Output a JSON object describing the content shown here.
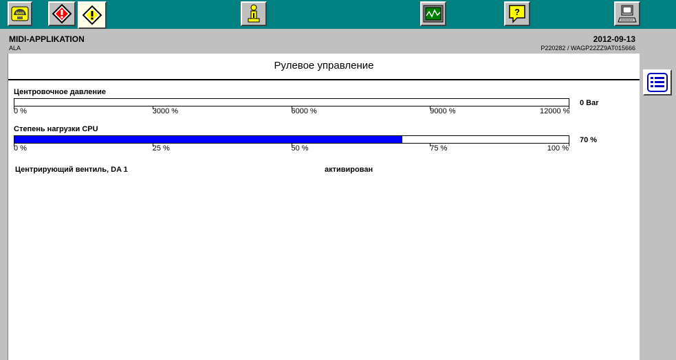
{
  "header": {
    "app_title": "MIDI-APPLIKATION",
    "app_subtitle": "ALA",
    "date": "2012-09-13",
    "vehicle_id": "P220282 / WAGP22ZZ9AT015666"
  },
  "toolbar": {
    "buttons": [
      {
        "icon": "man-logo-icon",
        "active": false
      },
      {
        "icon": "fault-warning-icon",
        "active": false
      },
      {
        "icon": "warning-diamond-icon",
        "active": true
      },
      {
        "icon": "info-person-icon",
        "active": false
      },
      {
        "icon": "oscilloscope-icon",
        "active": false
      },
      {
        "icon": "help-icon",
        "active": false
      },
      {
        "icon": "computer-icon",
        "active": false
      }
    ],
    "man_logo_text": "MAN"
  },
  "panel": {
    "title": "Рулевое управление",
    "gauges": [
      {
        "label": "Центровочное давление",
        "value_text": "0 Bar",
        "fraction": 0,
        "ticks": [
          "0 %",
          "3000 %",
          "6000 %",
          "9000 %",
          "12000 %"
        ]
      },
      {
        "label": "Степень нагрузки CPU",
        "value_text": "70 %",
        "fraction": 0.7,
        "ticks": [
          "0 %",
          "25 %",
          "50 %",
          "75 %",
          "100 %"
        ]
      }
    ],
    "rows": [
      {
        "label": "Центрирующий вентиль, DA 1",
        "value": "активирован"
      }
    ]
  },
  "sidebar": {
    "icon": "list-icon"
  },
  "colors": {
    "toolbar_bg": "#008080",
    "bar_fill": "#0000ff",
    "icon_yellow": "#ffff00"
  }
}
